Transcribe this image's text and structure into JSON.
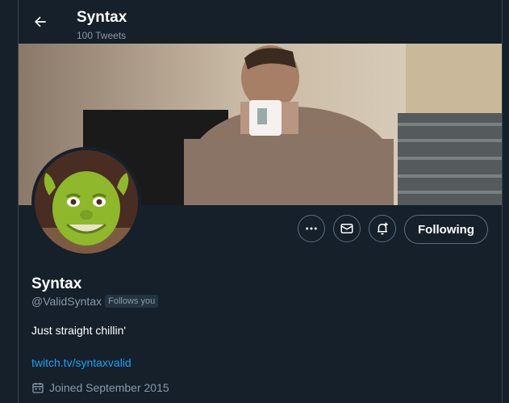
{
  "header": {
    "name": "Syntax",
    "tweet_count": "100 Tweets"
  },
  "profile": {
    "name": "Syntax",
    "handle": "@ValidSyntax",
    "follows_you": "Follows you",
    "bio": "Just straight chillin'",
    "link": "twitch.tv/syntaxvalid",
    "joined": "Joined September 2015"
  },
  "actions": {
    "following_label": "Following"
  },
  "icons": {
    "back": "back-arrow-icon",
    "more": "more-icon",
    "message": "envelope-icon",
    "notify": "bell-plus-icon",
    "calendar": "calendar-icon"
  },
  "colors": {
    "background": "#15202b",
    "border": "#38444d",
    "secondary_text": "#8899a6",
    "link": "#1da1f2"
  }
}
